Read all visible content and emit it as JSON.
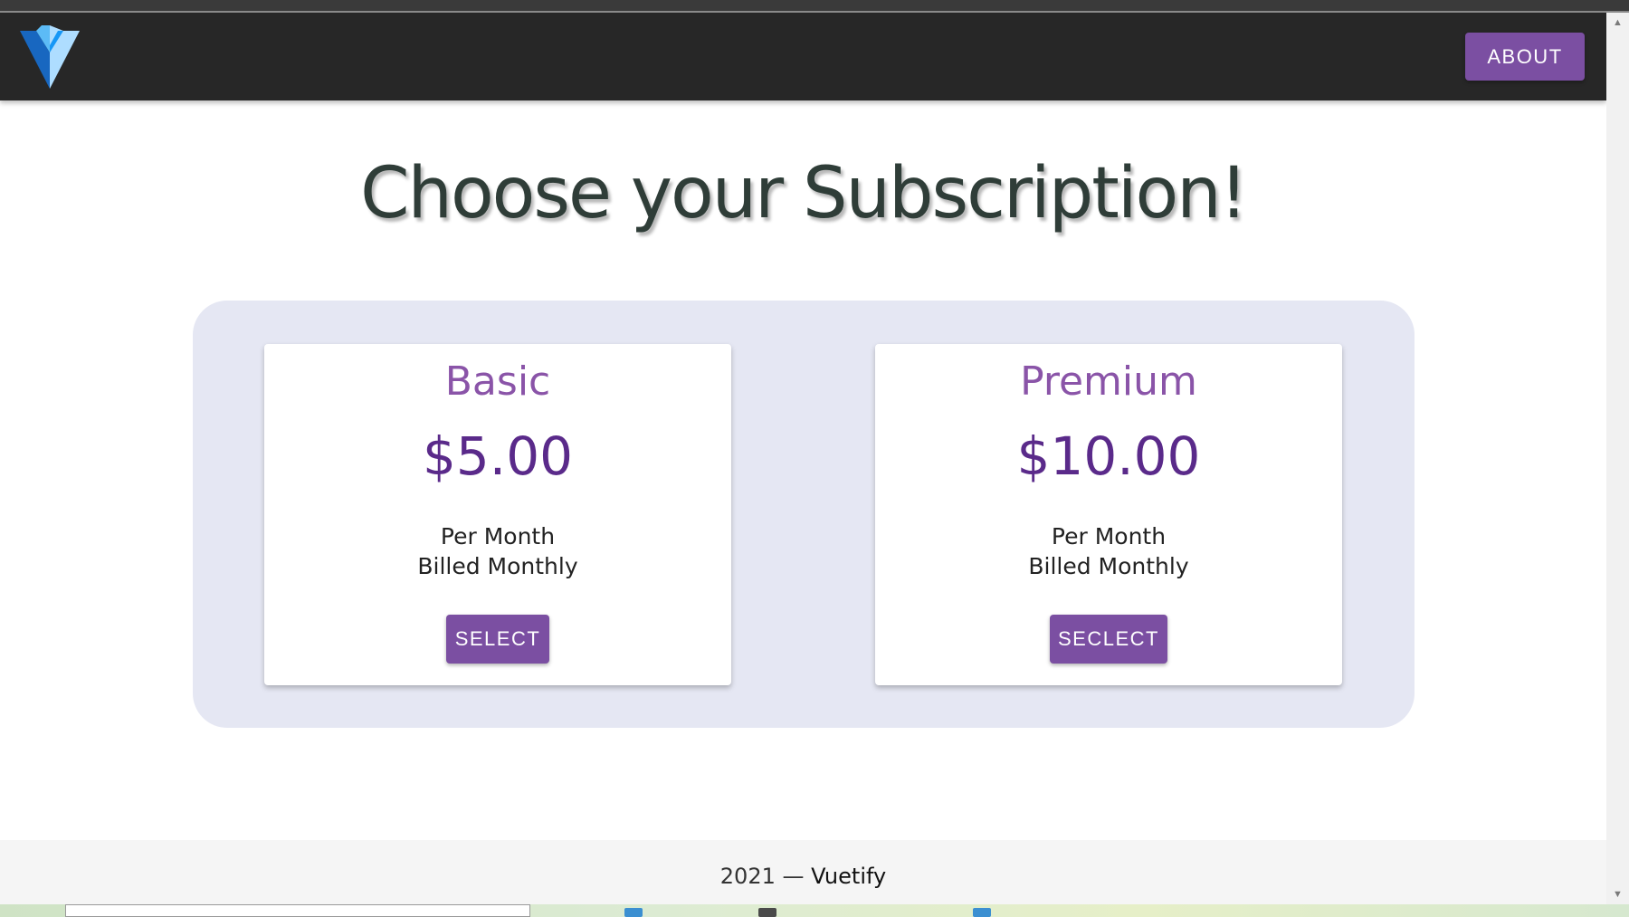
{
  "appbar": {
    "about_label": "ABOUT"
  },
  "page": {
    "title": "Choose your Subscription!"
  },
  "plans": [
    {
      "name": "Basic",
      "price": "$5.00",
      "period": "Per Month",
      "billing": "Billed Monthly",
      "button_label": "SELECT"
    },
    {
      "name": "Premium",
      "price": "$10.00",
      "period": "Per Month",
      "billing": "Billed Monthly",
      "button_label": "SECLECT"
    }
  ],
  "footer": {
    "year": "2021 —",
    "brand": "Vuetify"
  },
  "colors": {
    "appbar": "#272727",
    "accent": "#7b4fa2",
    "plan_name": "#8a54a8",
    "price": "#5a2a8a",
    "panel": "#e5e7f3",
    "title": "#2f3d38"
  },
  "icons": {
    "logo": "vuetify-logo-icon",
    "scroll_up": "scroll-up-arrow-icon",
    "scroll_down": "scroll-down-arrow-icon"
  }
}
